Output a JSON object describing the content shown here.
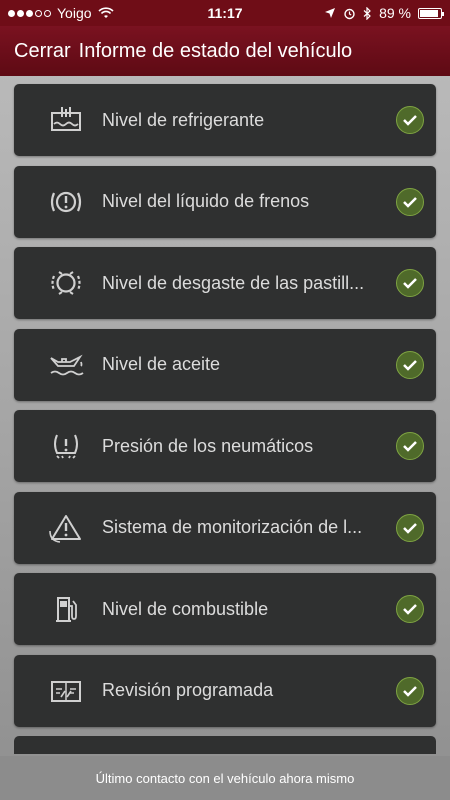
{
  "status_bar": {
    "carrier": "Yoigo",
    "time": "11:17",
    "battery": "89 %",
    "battery_level": 0.89,
    "signal_bars_filled": 3,
    "signal_bars_total": 5
  },
  "nav": {
    "close_label": "Cerrar",
    "title": "Informe de estado del vehículo"
  },
  "items": [
    {
      "label": "Nivel de refrigerante",
      "icon": "coolant-icon"
    },
    {
      "label": "Nivel del líquido de frenos",
      "icon": "brake-fluid-icon"
    },
    {
      "label": "Nivel de desgaste de las pastill...",
      "icon": "brake-pad-icon"
    },
    {
      "label": "Nivel de aceite",
      "icon": "oil-can-icon"
    },
    {
      "label": "Presión de los neumáticos",
      "icon": "tire-pressure-icon"
    },
    {
      "label": "Sistema de monitorización de l...",
      "icon": "warning-triangle-icon"
    },
    {
      "label": "Nivel de combustible",
      "icon": "fuel-pump-icon"
    },
    {
      "label": "Revisión programada",
      "icon": "service-book-icon"
    }
  ],
  "footer": {
    "text": "Último contacto con el vehículo ahora mismo"
  },
  "colors": {
    "accent": "#6f0d17",
    "row_bg": "#2f3030",
    "check_bg": "#4f6a2a"
  }
}
